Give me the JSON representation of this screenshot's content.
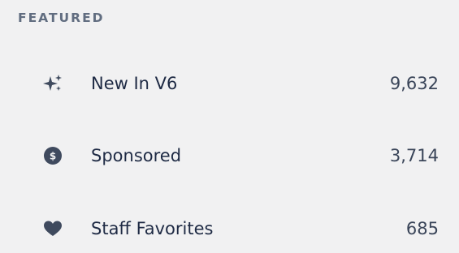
{
  "featured": {
    "title": "FEATURED",
    "items": [
      {
        "icon": "sparkles-icon",
        "label": "New In V6",
        "count": "9,632"
      },
      {
        "icon": "dollar-coin-icon",
        "label": "Sponsored",
        "count": "3,714"
      },
      {
        "icon": "heart-icon",
        "label": "Staff Favorites",
        "count": "685"
      }
    ]
  },
  "colors": {
    "background": "#f1f1f2",
    "title": "#616d80",
    "text": "#1e2a44",
    "icon": "#3f4a5e"
  }
}
